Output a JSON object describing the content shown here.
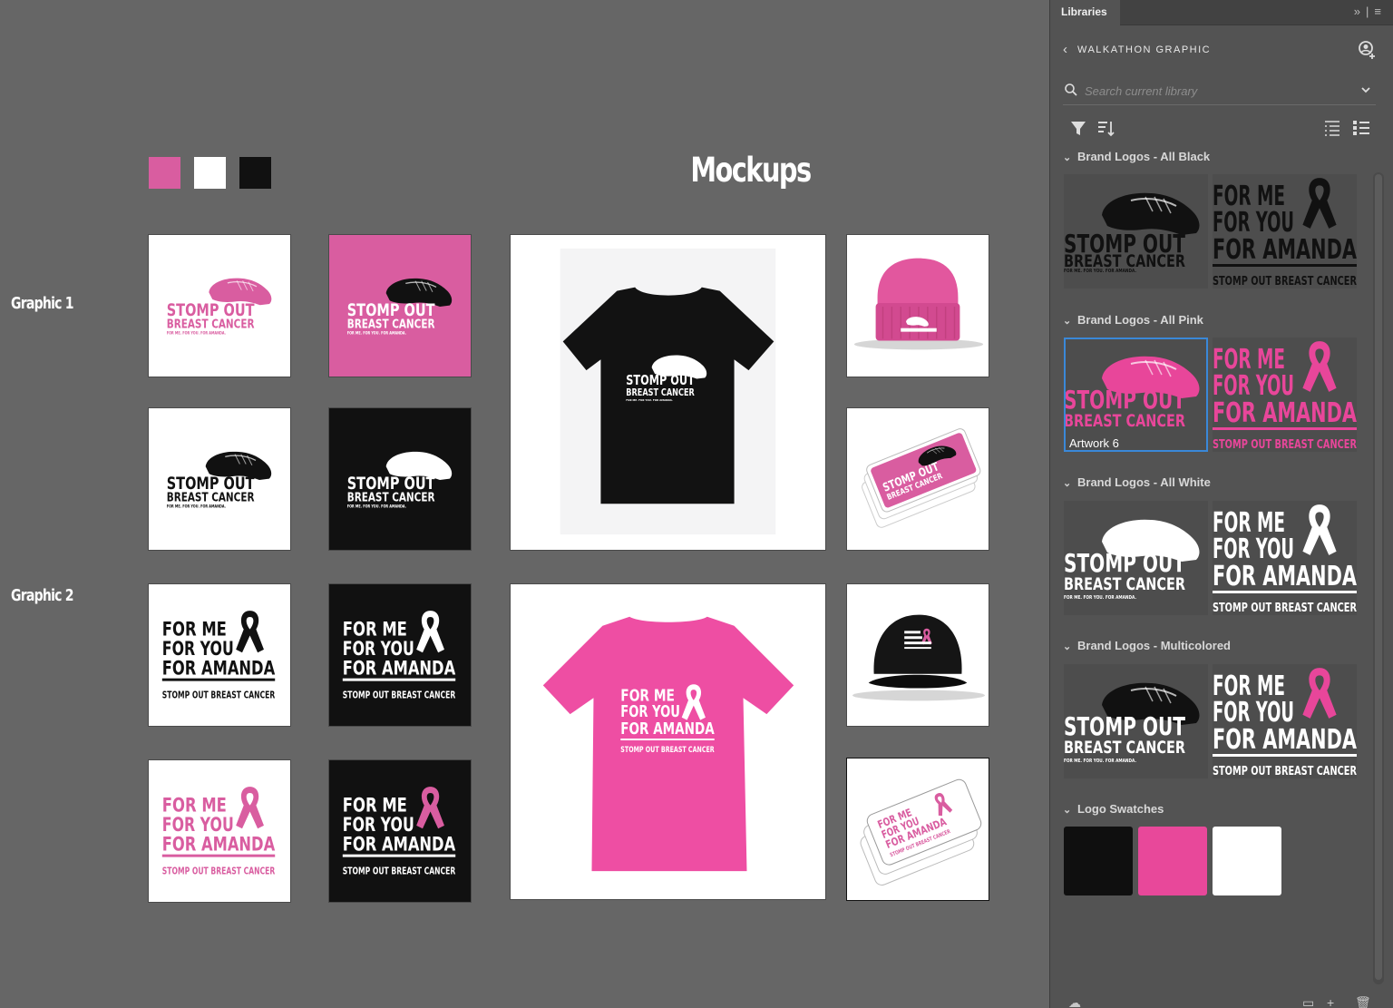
{
  "canvas": {
    "title": "Mockups",
    "row_labels": [
      "Graphic 1",
      "Graphic 2"
    ],
    "swatch_colors": [
      "#d95da0",
      "#ffffff",
      "#111111"
    ]
  },
  "logos": {
    "g1": {
      "line1": "STOMP OUT",
      "line2": "BREAST CANCER",
      "tag": "FOR ME. FOR YOU. FOR AMANDA."
    },
    "g2": {
      "line1": "FOR ME",
      "line2": "FOR YOU",
      "line3": "FOR AMANDA",
      "tag": "STOMP OUT BREAST CANCER"
    }
  },
  "colors": {
    "pink": "#d95da0",
    "hot_pink": "#e8469a",
    "black": "#111111",
    "white": "#ffffff"
  },
  "panel": {
    "tab_label": "Libraries",
    "library_name": "WALKATHON GRAPHIC",
    "search_placeholder": "Search current library",
    "sections": [
      {
        "title": "Brand Logos - All Black"
      },
      {
        "title": "Brand Logos - All Pink",
        "selected_label": "Artwork 6"
      },
      {
        "title": "Brand Logos - All White"
      },
      {
        "title": "Brand Logos - Multicolored"
      },
      {
        "title": "Logo Swatches"
      }
    ],
    "logo_swatches": [
      "#0f0f0f",
      "#e8489a",
      "#ffffff"
    ],
    "icons": [
      "collapse-icon",
      "menu-icon",
      "back-chevron-icon",
      "user-add-icon",
      "search-icon",
      "chevron-down-icon",
      "filter-icon",
      "sort-icon",
      "list-view-icon",
      "detail-view-icon",
      "cloud-icon",
      "folder-icon",
      "add-icon",
      "trash-icon"
    ]
  }
}
